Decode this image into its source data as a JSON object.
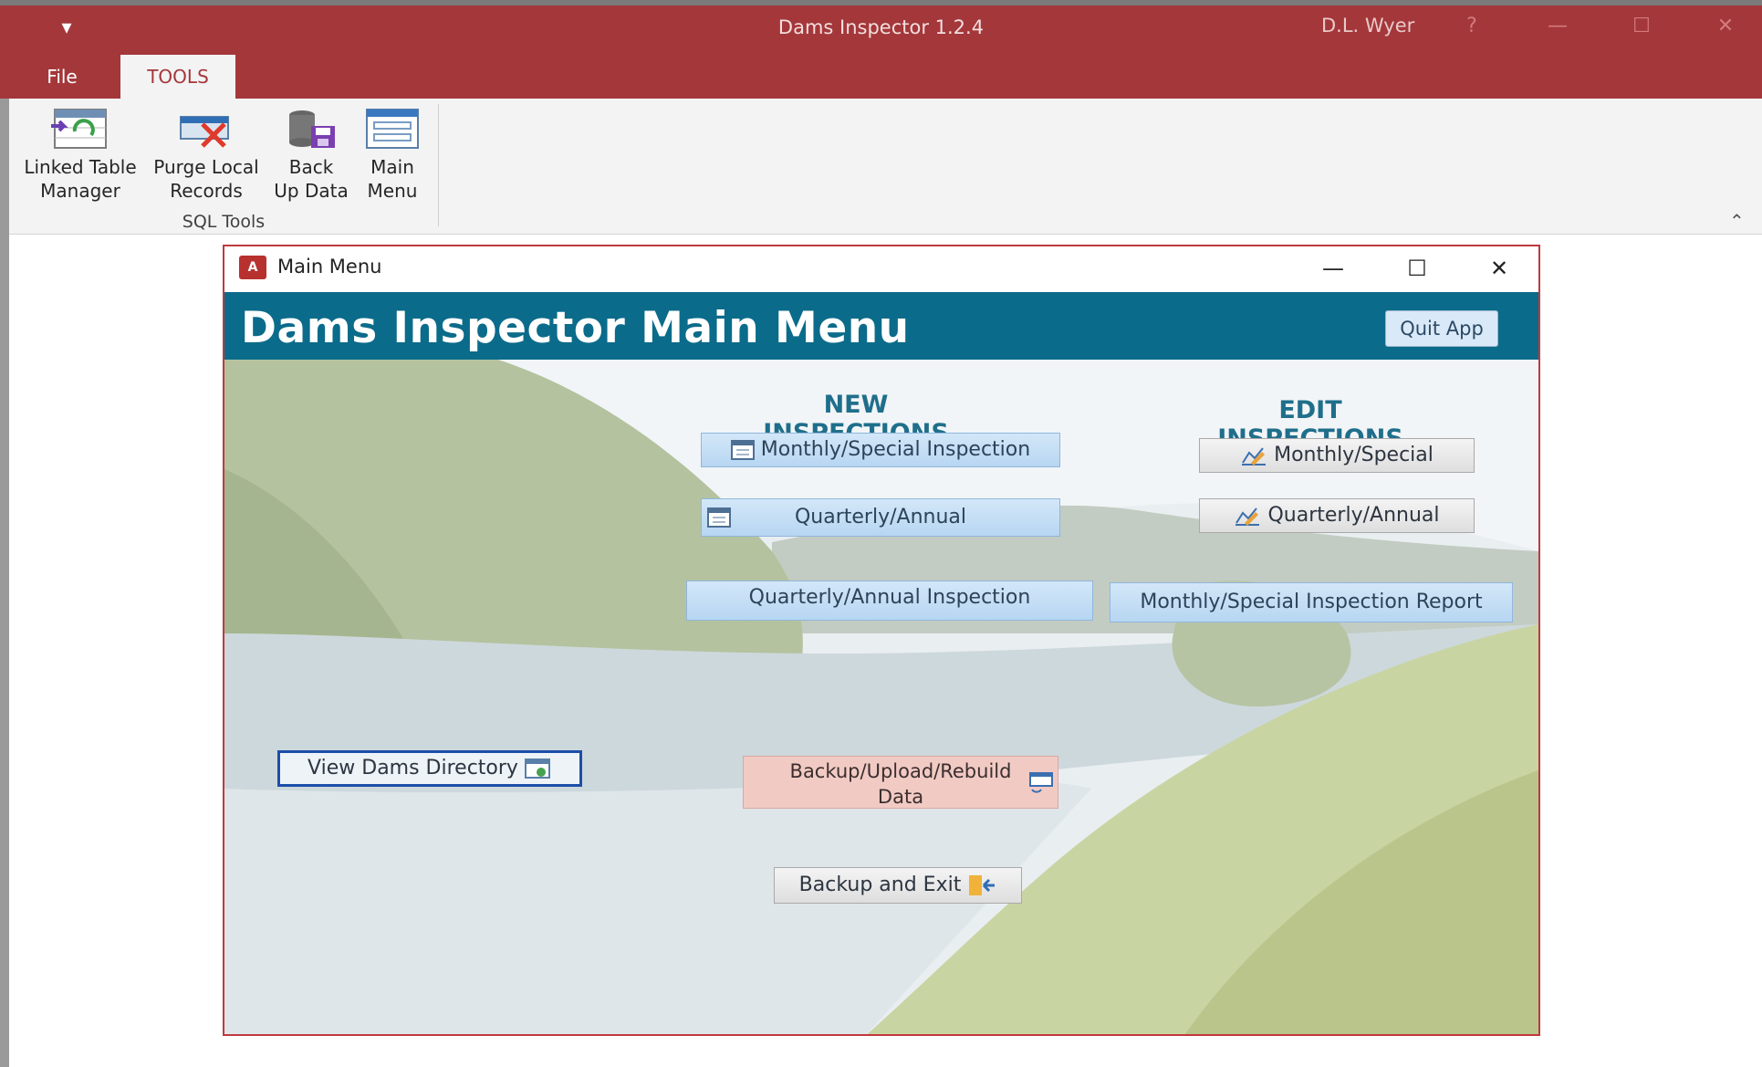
{
  "app": {
    "title": "Dams Inspector 1.2.4",
    "user": "D.L. Wyer",
    "quick_access": "▾",
    "help": "?",
    "min": "—",
    "max": "☐",
    "close": "✕"
  },
  "ribbon": {
    "tabs": [
      "File",
      "TOOLS"
    ],
    "active_tab": "TOOLS",
    "buttons": [
      {
        "line1": "Linked Table",
        "line2": "Manager",
        "icon": "linked-table-icon"
      },
      {
        "line1": "Purge Local",
        "line2": "Records",
        "icon": "purge-records-icon"
      },
      {
        "line1": "Back",
        "line2": "Up Data",
        "icon": "backup-database-icon"
      },
      {
        "line1": "Main",
        "line2": "Menu",
        "icon": "main-menu-icon"
      }
    ],
    "group_label": "SQL Tools",
    "collapse_glyph": "⌃"
  },
  "window": {
    "title": "Main Menu",
    "logo_text": "A",
    "min": "—",
    "max": "☐",
    "close": "✕"
  },
  "form": {
    "heading": "Dams Inspector Main Menu",
    "quit": "Quit App",
    "new_title": "NEW INSPECTIONS",
    "edit_title": "EDIT INSPECTIONS",
    "new_monthly": "Monthly/Special Inspection",
    "new_quarterly": "Quarterly/Annual",
    "edit_monthly": "Monthly/Special",
    "edit_quarterly": "Quarterly/Annual",
    "report_quarterly": "Quarterly/Annual Inspection",
    "report_monthly": "Monthly/Special Inspection Report",
    "view_directory": "View Dams Directory",
    "backup_upload_line1": "Backup/Upload/Rebuild",
    "backup_upload_line2": "Data",
    "backup_exit": "Backup and Exit"
  },
  "colors": {
    "title_bar": "#a4373a",
    "header_band": "#0b6b8a",
    "section_title": "#1f6f8b"
  }
}
